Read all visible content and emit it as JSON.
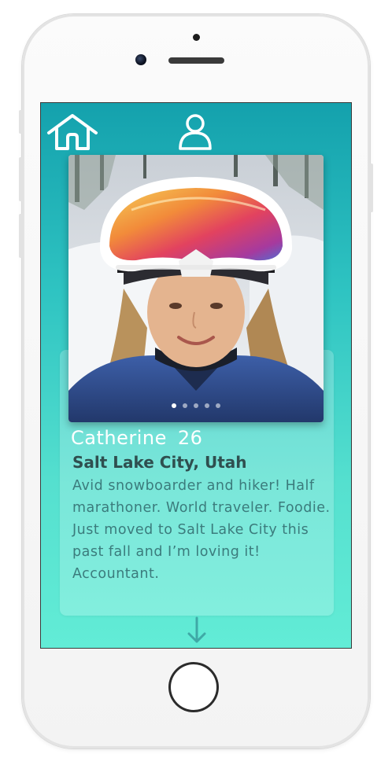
{
  "nav": {
    "home_icon": "home-icon",
    "profile_icon": "user-icon"
  },
  "profile": {
    "name": "Catherine",
    "age": "26",
    "location": "Salt Lake City, Utah",
    "bio": "Avid snowboarder and hiker! Half marathoner. World traveler. Foodie. Just moved to Salt Lake City this past fall and I’m loving it! Accountant.",
    "photo_count": 5,
    "active_photo_index": 0
  },
  "footer": {
    "scroll_icon": "arrow-down-icon"
  },
  "colors": {
    "screen_top": "#14a1ad",
    "screen_bottom": "#62ecd6",
    "name_text": "#ffffff",
    "location_text": "#2f4f4f",
    "bio_text": "#3b7b7c"
  }
}
